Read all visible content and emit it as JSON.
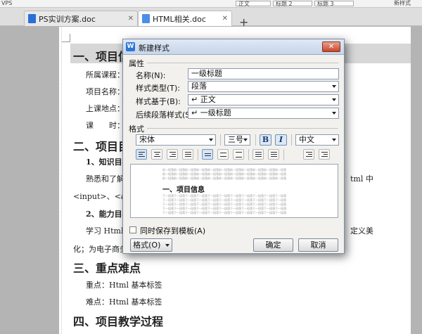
{
  "toolbar": {
    "left_label": "VPS",
    "font_style_box": "正文",
    "style_box_2": "标题 2",
    "style_box_3": "标题 3",
    "right_label": "新样式"
  },
  "tabs": [
    {
      "label": "PS实训方案.doc",
      "close": "✕"
    },
    {
      "label": "HTML相关.doc",
      "close": "✕"
    }
  ],
  "tab_new_label": "+",
  "document": {
    "heading1": "一、项目信",
    "lines": [
      "所属课程：",
      "项目名称：",
      "上课地点：",
      "课　　时：",
      "二、项目目",
      "1、知识目标",
      "熟悉和了解",
      "<input>、<a>等",
      "2、能力目标",
      "学习 Html 的",
      "化；为电子商务",
      "tml 中",
      "定义美",
      "三、重点难点",
      "重点：Html 基本标签",
      "难点：Html 基本标签",
      "四、项目教学过程"
    ]
  },
  "dialog": {
    "app_icon_letter": "W",
    "title": "新建样式",
    "close_label": "✕",
    "section_properties": "属性",
    "name_label": "名称(N):",
    "name_value": "一级标题",
    "type_label": "样式类型(T):",
    "type_value": "段落",
    "based_on_label": "样式基于(B):",
    "based_on_value": "↵ 正文",
    "next_style_label": "后续段落样式(S):",
    "next_style_value": "↵ 一级标题",
    "section_format": "格式",
    "font_value": "宋体",
    "size_value": "三号",
    "bold_label": "B",
    "italic_label": "I",
    "lang_value": "中文",
    "preview_filler": "前一段落前一段落前一段落前一段落前一段落前一段落前一段落前一段落前一段落前一段落前一段落",
    "preview_heading": "一、项目信息",
    "preview_after": "下一段落下一段落下一段落下一段落下一段落下一段落下一段落下一段落下一段落下一段落下一段落",
    "save_to_template_label": "同时保存到模板(A)",
    "format_button_label": "格式(O)",
    "ok_label": "确定",
    "cancel_label": "取消"
  }
}
